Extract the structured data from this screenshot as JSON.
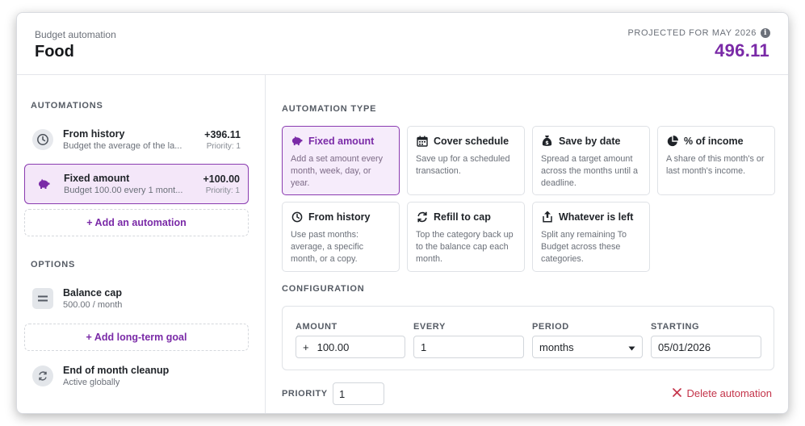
{
  "header": {
    "subtitle": "Budget automation",
    "title": "Food",
    "projected_label": "PROJECTED FOR MAY 2026",
    "projected_value": "496.11"
  },
  "sidebar": {
    "automations_title": "AUTOMATIONS",
    "automations": [
      {
        "name": "From history",
        "desc": "Budget the average of the la...",
        "amount": "+396.11",
        "priority": "Priority: 1",
        "icon": "clock-icon"
      },
      {
        "name": "Fixed amount",
        "desc": "Budget 100.00 every 1 mont...",
        "amount": "+100.00",
        "priority": "Priority: 1",
        "icon": "piggy-bank-icon"
      }
    ],
    "add_automation": "+ Add an automation",
    "options_title": "OPTIONS",
    "options": [
      {
        "name": "Balance cap",
        "desc": "500.00 / month",
        "icon": "equals-icon"
      },
      {
        "name": "End of month cleanup",
        "desc": "Active globally",
        "icon": "cycle-icon"
      }
    ],
    "add_goal": "+ Add long-term goal"
  },
  "main": {
    "type_title": "AUTOMATION TYPE",
    "types": [
      {
        "name": "Fixed amount",
        "desc": "Add a set amount every month, week, day, or year.",
        "icon": "piggy-bank-icon"
      },
      {
        "name": "Cover schedule",
        "desc": "Save up for a scheduled transaction.",
        "icon": "calendar-icon"
      },
      {
        "name": "Save by date",
        "desc": "Spread a target amount across the months until a deadline.",
        "icon": "money-bag-icon"
      },
      {
        "name": "% of income",
        "desc": "A share of this month's or last month's income.",
        "icon": "pie-chart-icon"
      },
      {
        "name": "From history",
        "desc": "Use past months: average, a specific month, or a copy.",
        "icon": "clock-icon"
      },
      {
        "name": "Refill to cap",
        "desc": "Top the category back up to the balance cap each month.",
        "icon": "refresh-icon"
      },
      {
        "name": "Whatever is left",
        "desc": "Split any remaining To Budget across these categories.",
        "icon": "upload-icon"
      }
    ],
    "config_title": "CONFIGURATION",
    "config": {
      "amount_label": "AMOUNT",
      "amount_prefix": "+",
      "amount_value": "100.00",
      "every_label": "EVERY",
      "every_value": "1",
      "period_label": "PERIOD",
      "period_value": "months",
      "starting_label": "STARTING",
      "starting_value": "05/01/2026"
    },
    "priority_label": "PRIORITY",
    "priority_value": "1",
    "delete_label": "Delete automation"
  },
  "colors": {
    "accent": "#7a2aa7",
    "selected_bg": "#f4e7f9",
    "danger": "#c4344a"
  }
}
